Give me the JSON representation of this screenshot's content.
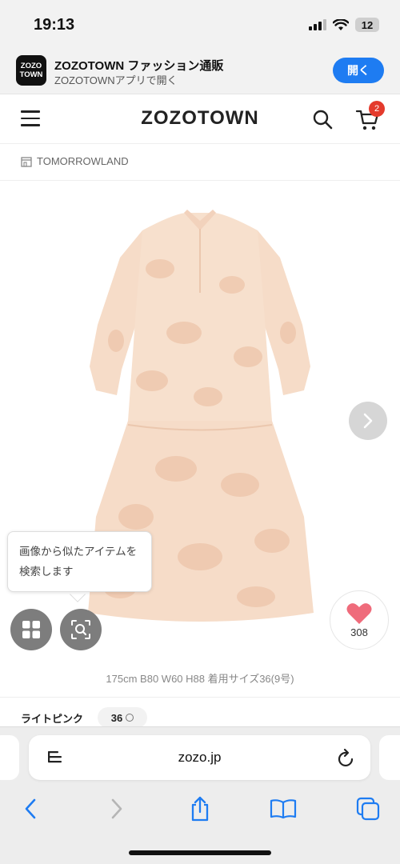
{
  "status_bar": {
    "time": "19:13",
    "battery": "12"
  },
  "app_banner": {
    "logo_line1": "ZOZO",
    "logo_line2": "TOWN",
    "title": "ZOZOTOWN ファッション通販",
    "subtitle": "ZOZOTOWNアプリで開く",
    "open_label": "開く"
  },
  "header": {
    "logo": "ZOZOTOWN",
    "cart_count": "2"
  },
  "brand": {
    "name": "TOMORROWLAND"
  },
  "product": {
    "tooltip_line1": "画像から似たアイテムを",
    "tooltip_line2": "検索します",
    "favorite_count": "308",
    "model_info": "175cm B80 W60 H88 着用サイズ36(9号)"
  },
  "variant": {
    "color": "ライトピンク",
    "size": "36"
  },
  "browser": {
    "url": "zozo.jp"
  },
  "colors": {
    "accent_blue": "#1e7cf2",
    "badge_red": "#e43a2c",
    "heart_pink": "#ef6b7b",
    "dress": "#f6dcc8"
  },
  "icons": [
    "menu-icon",
    "search-icon",
    "cart-icon",
    "store-icon",
    "chevron-right-icon",
    "grid-icon",
    "image-search-icon",
    "heart-icon",
    "reader-icon",
    "reload-icon",
    "back-icon",
    "forward-icon",
    "share-icon",
    "bookmarks-icon",
    "tabs-icon"
  ]
}
